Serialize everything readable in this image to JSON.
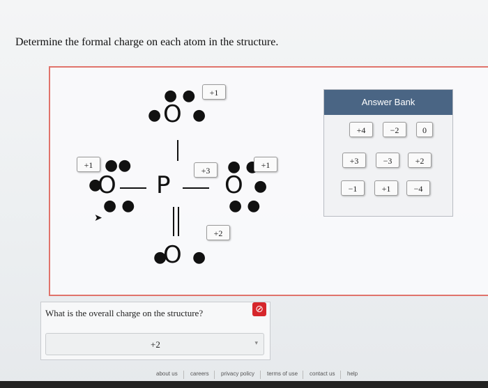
{
  "question": "Determine the formal charge on each atom in the structure.",
  "structure": {
    "atoms": {
      "top_o": "O",
      "left_o": "O",
      "center_p": "P",
      "right_o": "O",
      "bottom_o": "O"
    },
    "placed_charges": {
      "top_o": "+1",
      "left_o": "+1",
      "center_p": "+3",
      "right_o": "+1",
      "bottom_o": "+2"
    }
  },
  "answer_bank": {
    "title": "Answer Bank",
    "chips": [
      "+4",
      "−2",
      "0",
      "+3",
      "−3",
      "+2",
      "−1",
      "+1",
      "−4"
    ]
  },
  "overall": {
    "question": "What is the overall charge on the structure?",
    "selected": "+2"
  },
  "footer": {
    "links": [
      "about us",
      "careers",
      "privacy policy",
      "terms of use",
      "contact us",
      "help"
    ]
  },
  "colors": {
    "canvas_border": "#e0736b",
    "bank_header": "#4a6584",
    "error": "#d6262b"
  }
}
